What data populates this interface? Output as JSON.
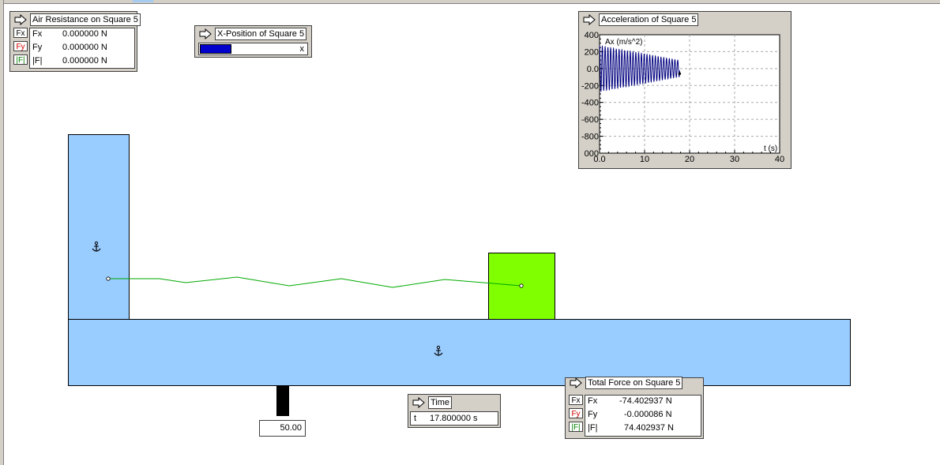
{
  "colors": {
    "body_blue": "#99ccff",
    "square_green": "#80ff00",
    "spring_green": "#00aa00",
    "plot_line": "#000080",
    "bar_fill": "#0000cc"
  },
  "air_resistance": {
    "title": "Air Resistance on Square 5",
    "rows": [
      {
        "button": "Fx",
        "label": "Fx",
        "value": "0.000000 N",
        "color": "#000000"
      },
      {
        "button": "Fy",
        "label": "Fy",
        "value": "0.000000 N",
        "color": "#cc0000"
      },
      {
        "button": "|F|",
        "label": "|F|",
        "value": "0.000000 N",
        "color": "#008000"
      }
    ]
  },
  "x_position": {
    "title": "X-Position of Square 5",
    "axis_label": "x",
    "fill_fraction": 0.29
  },
  "acceleration": {
    "title": "Acceleration of Square 5",
    "ylabel": "Ax (m/s^2)",
    "xlabel": "t (s)",
    "xticks": [
      "0.0",
      "10",
      "20",
      "30",
      "40"
    ],
    "yticks": [
      "400",
      "200",
      "0.0",
      "-200",
      "-400",
      "-600",
      "-800",
      "000"
    ]
  },
  "chart_data": {
    "type": "line",
    "xlabel": "t (s)",
    "ylabel": "Ax (m/s^2)",
    "xlim": [
      0,
      40
    ],
    "ylim": [
      -1000,
      400
    ],
    "grid": true,
    "series": [
      {
        "amplitude_start": 270,
        "amplitude_end": 95,
        "t_end": 17.8,
        "period": 0.62,
        "end_value": -60
      }
    ]
  },
  "time": {
    "title": "Time",
    "label": "t",
    "value": "17.800000 s"
  },
  "total_force": {
    "title": "Total Force on Square 5",
    "rows": [
      {
        "button": "Fx",
        "label": "Fx",
        "value": "-74.402937 N",
        "color": "#000000"
      },
      {
        "button": "Fy",
        "label": "Fy",
        "value": "-0.000086 N",
        "color": "#cc0000"
      },
      {
        "button": "|F|",
        "label": "|F|",
        "value": "74.402937 N",
        "color": "#008000"
      }
    ]
  },
  "slider": {
    "value": "50.00"
  }
}
